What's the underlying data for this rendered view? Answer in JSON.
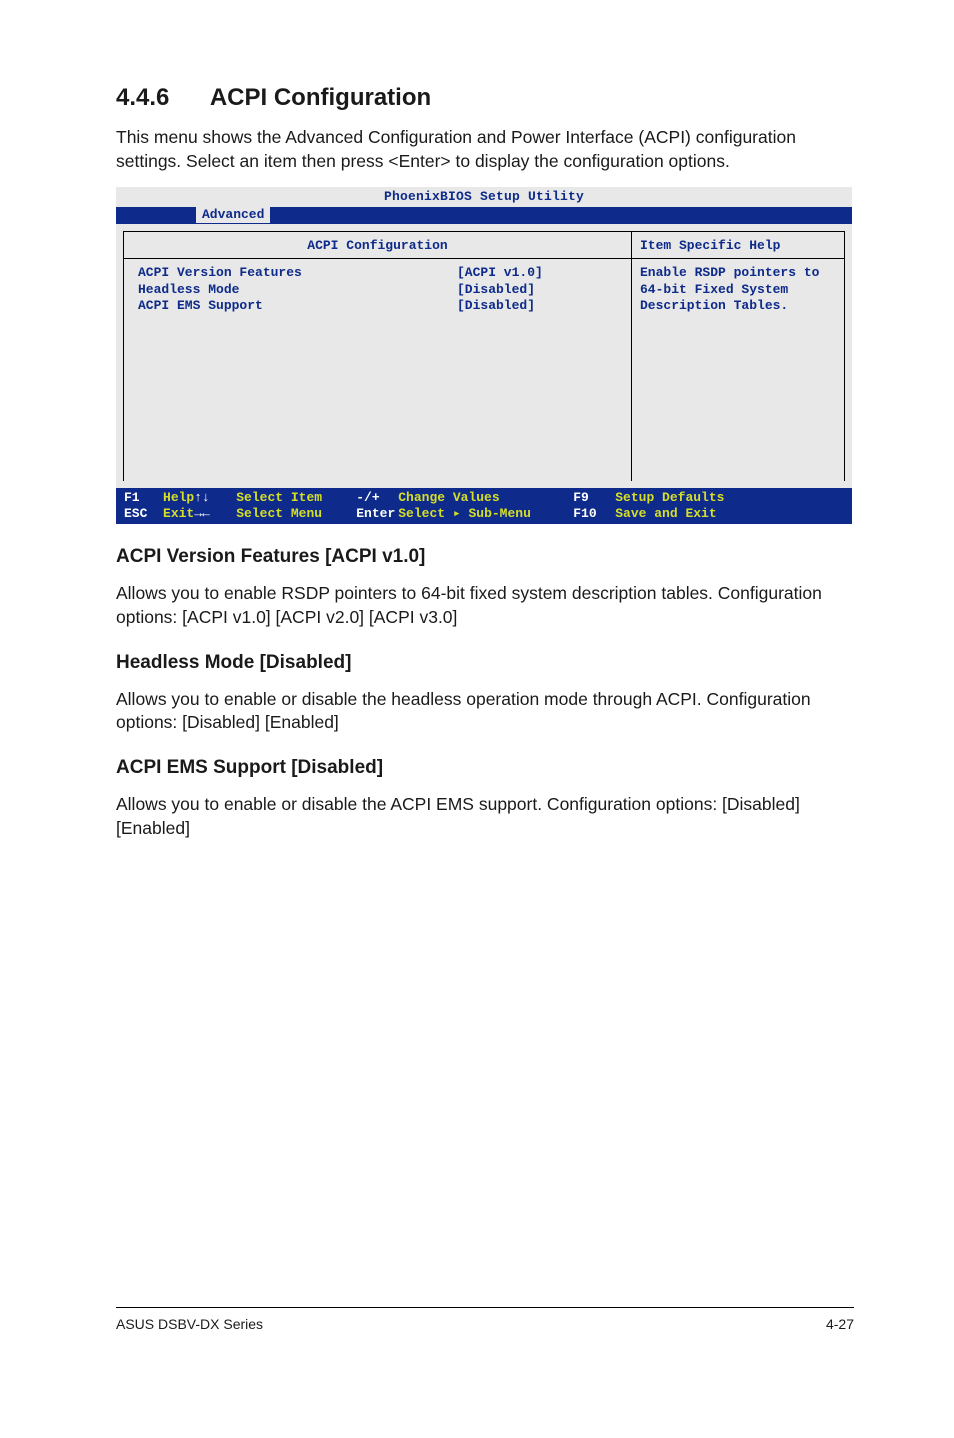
{
  "section": {
    "number": "4.4.6",
    "title": "ACPI Configuration",
    "intro": "This menu shows the Advanced Configuration and Power Interface (ACPI) configuration settings. Select an item then press <Enter> to display the configuration options."
  },
  "bios": {
    "title": "PhoenixBIOS Setup Utility",
    "active_tab": "Advanced",
    "panel_title": "ACPI Configuration",
    "help_title": "Item Specific Help",
    "items": [
      {
        "label": "ACPI Version Features",
        "value": "[ACPI v1.0]"
      },
      {
        "label": "Headless Mode",
        "value": "[Disabled]"
      },
      {
        "label": "ACPI EMS Support",
        "value": "[Disabled]"
      }
    ],
    "help_text_l1": "Enable RSDP pointers to",
    "help_text_l2": "64-bit Fixed System",
    "help_text_l3": "Description Tables.",
    "footer": {
      "r1": {
        "k1": "F1",
        "l1": "Help",
        "k2": "↑↓",
        "l2": "Select Item",
        "k3": "-/+",
        "l3": "Change Values",
        "k4": "F9",
        "l4": "Setup Defaults"
      },
      "r2": {
        "k1": "ESC",
        "l1": "Exit",
        "k2": "→←",
        "l2": "Select Menu",
        "k3": "Enter",
        "l3": "Select ▸ Sub-Menu",
        "k4": "F10",
        "l4": "Save and Exit"
      }
    }
  },
  "subsections": {
    "s1": {
      "heading": "ACPI Version Features [ACPI v1.0]",
      "p1": "Allows you to enable RSDP pointers to 64-bit fixed system description tables. Configuration options: [ACPI v1.0] [ACPI v2.0] [ACPI v3.0]"
    },
    "s2": {
      "heading": "Headless Mode [Disabled]",
      "p1": "Allows you to enable or disable the headless operation mode through ACPI. Configuration options: [Disabled] [Enabled]"
    },
    "s3": {
      "heading": "ACPI EMS Support [Disabled]",
      "p1": "Allows you to enable or disable the ACPI EMS support. Configuration options: [Disabled] [Enabled]"
    }
  },
  "footer": {
    "left": "ASUS DSBV-DX Series",
    "right": "4-27"
  }
}
